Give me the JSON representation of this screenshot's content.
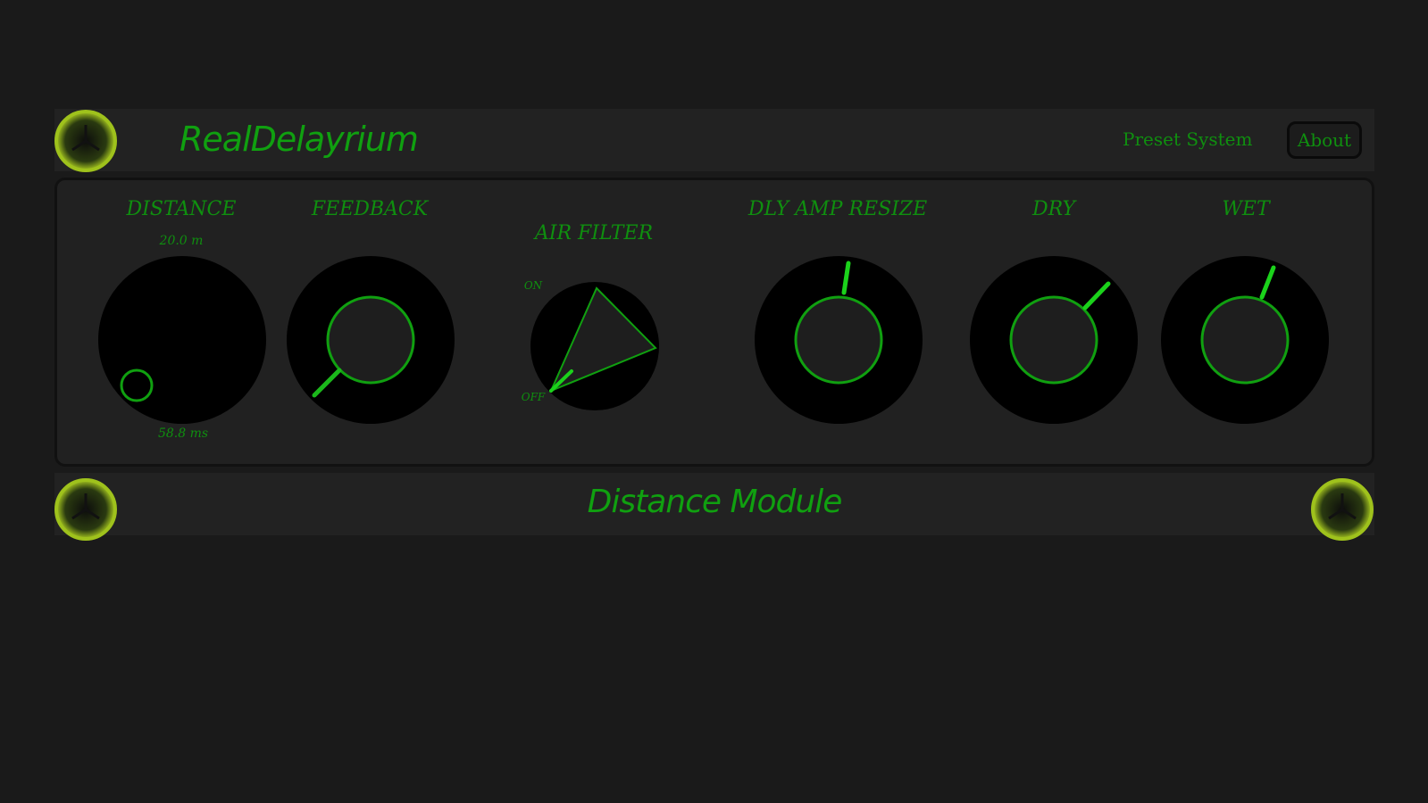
{
  "app": {
    "title": "RealDelayrium",
    "module_name": "Distance Module"
  },
  "header": {
    "preset_label": "Preset System",
    "about_label": "About"
  },
  "colors": {
    "accent_green": "#10a010",
    "bright_green": "#1bd21b",
    "screw_ring": "#a8c91f",
    "panel_bg": "#212121",
    "page_bg": "#1a1a1a"
  },
  "controls": {
    "distance": {
      "label": "DISTANCE",
      "min_label": "20.0 m",
      "value_label": "58.8 ms",
      "value": 0.0
    },
    "feedback": {
      "label": "FEEDBACK",
      "value": 0.0
    },
    "air_filter": {
      "label": "AIR FILTER",
      "on_label": "ON",
      "off_label": "OFF",
      "state": "off"
    },
    "dly_amp_resize": {
      "label": "DLY AMP RESIZE",
      "value": 0.55
    },
    "dry": {
      "label": "DRY",
      "value": 0.7
    },
    "wet": {
      "label": "WET",
      "value": 0.6
    }
  },
  "icons": {
    "screw": "screw-icon"
  }
}
